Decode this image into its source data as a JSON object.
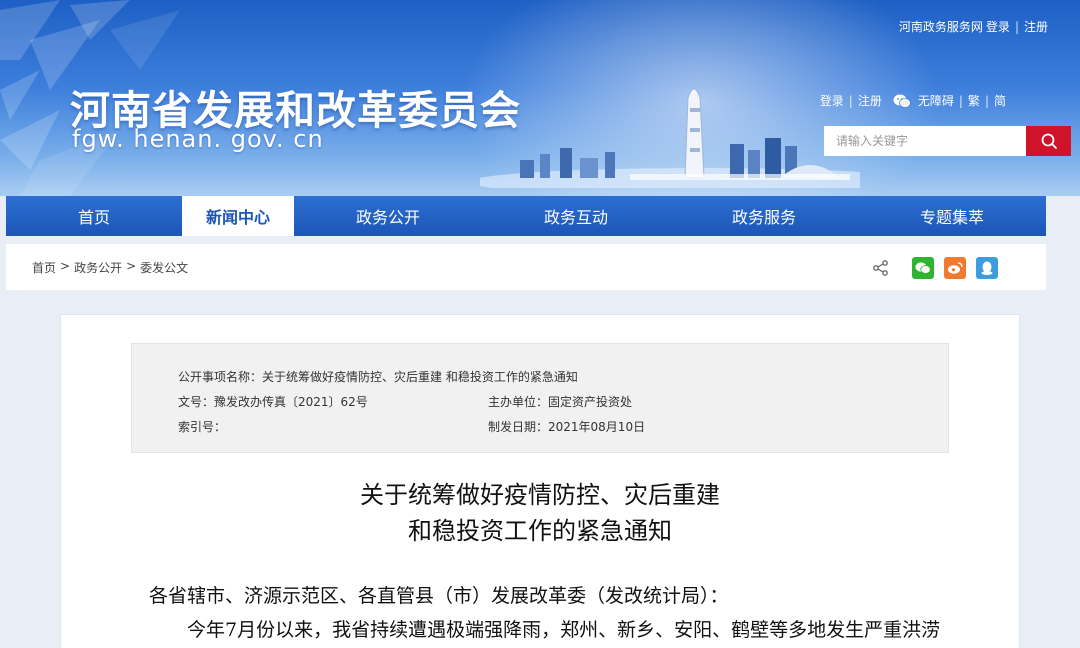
{
  "header": {
    "title": "河南省发展和改革委员会",
    "domain": "fgw. henan. gov. cn",
    "topbar": {
      "portal": "河南政务服务网",
      "login": "登录",
      "register": "注册"
    },
    "util": {
      "login": "登录",
      "register": "注册",
      "accessible": "无障碍",
      "traditional": "繁",
      "simplified": "简"
    },
    "search": {
      "placeholder": "请输入关键字"
    }
  },
  "nav": [
    {
      "label": "首页"
    },
    {
      "label": "新闻中心"
    },
    {
      "label": "政务公开"
    },
    {
      "label": "政务互动"
    },
    {
      "label": "政务服务"
    },
    {
      "label": "专题集萃"
    }
  ],
  "breadcrumb": [
    "首页",
    "政务公开",
    "委发公文"
  ],
  "breadcrumb_sep": ">",
  "meta": {
    "item_name": "公开事项名称：关于统筹做好疫情防控、灾后重建 和稳投资工作的紧急通知",
    "doc_no": "文号：豫发改办传真〔2021〕62号",
    "department": "主办单位：固定资产投资处",
    "index_no": "索引号：",
    "date": "制发日期：2021年08月10日"
  },
  "document": {
    "title_line1": "关于统筹做好疫情防控、灾后重建",
    "title_line2": "和稳投资工作的紧急通知",
    "salutation": "各省辖市、济源示范区、各直管县（市）发展改革委（发改统计局）：",
    "paragraph1": "今年7月份以来，我省持续遭遇极端强降雨，郑州、新乡、安阳、鹤壁等多地发生严重洪涝"
  },
  "colors": {
    "banner": "#2d6fd1",
    "nav": "#1b56b8",
    "search_button": "#d0132a",
    "wechat": "#2fb42f",
    "weibo": "#f07a2d",
    "qq": "#3d9be0"
  }
}
